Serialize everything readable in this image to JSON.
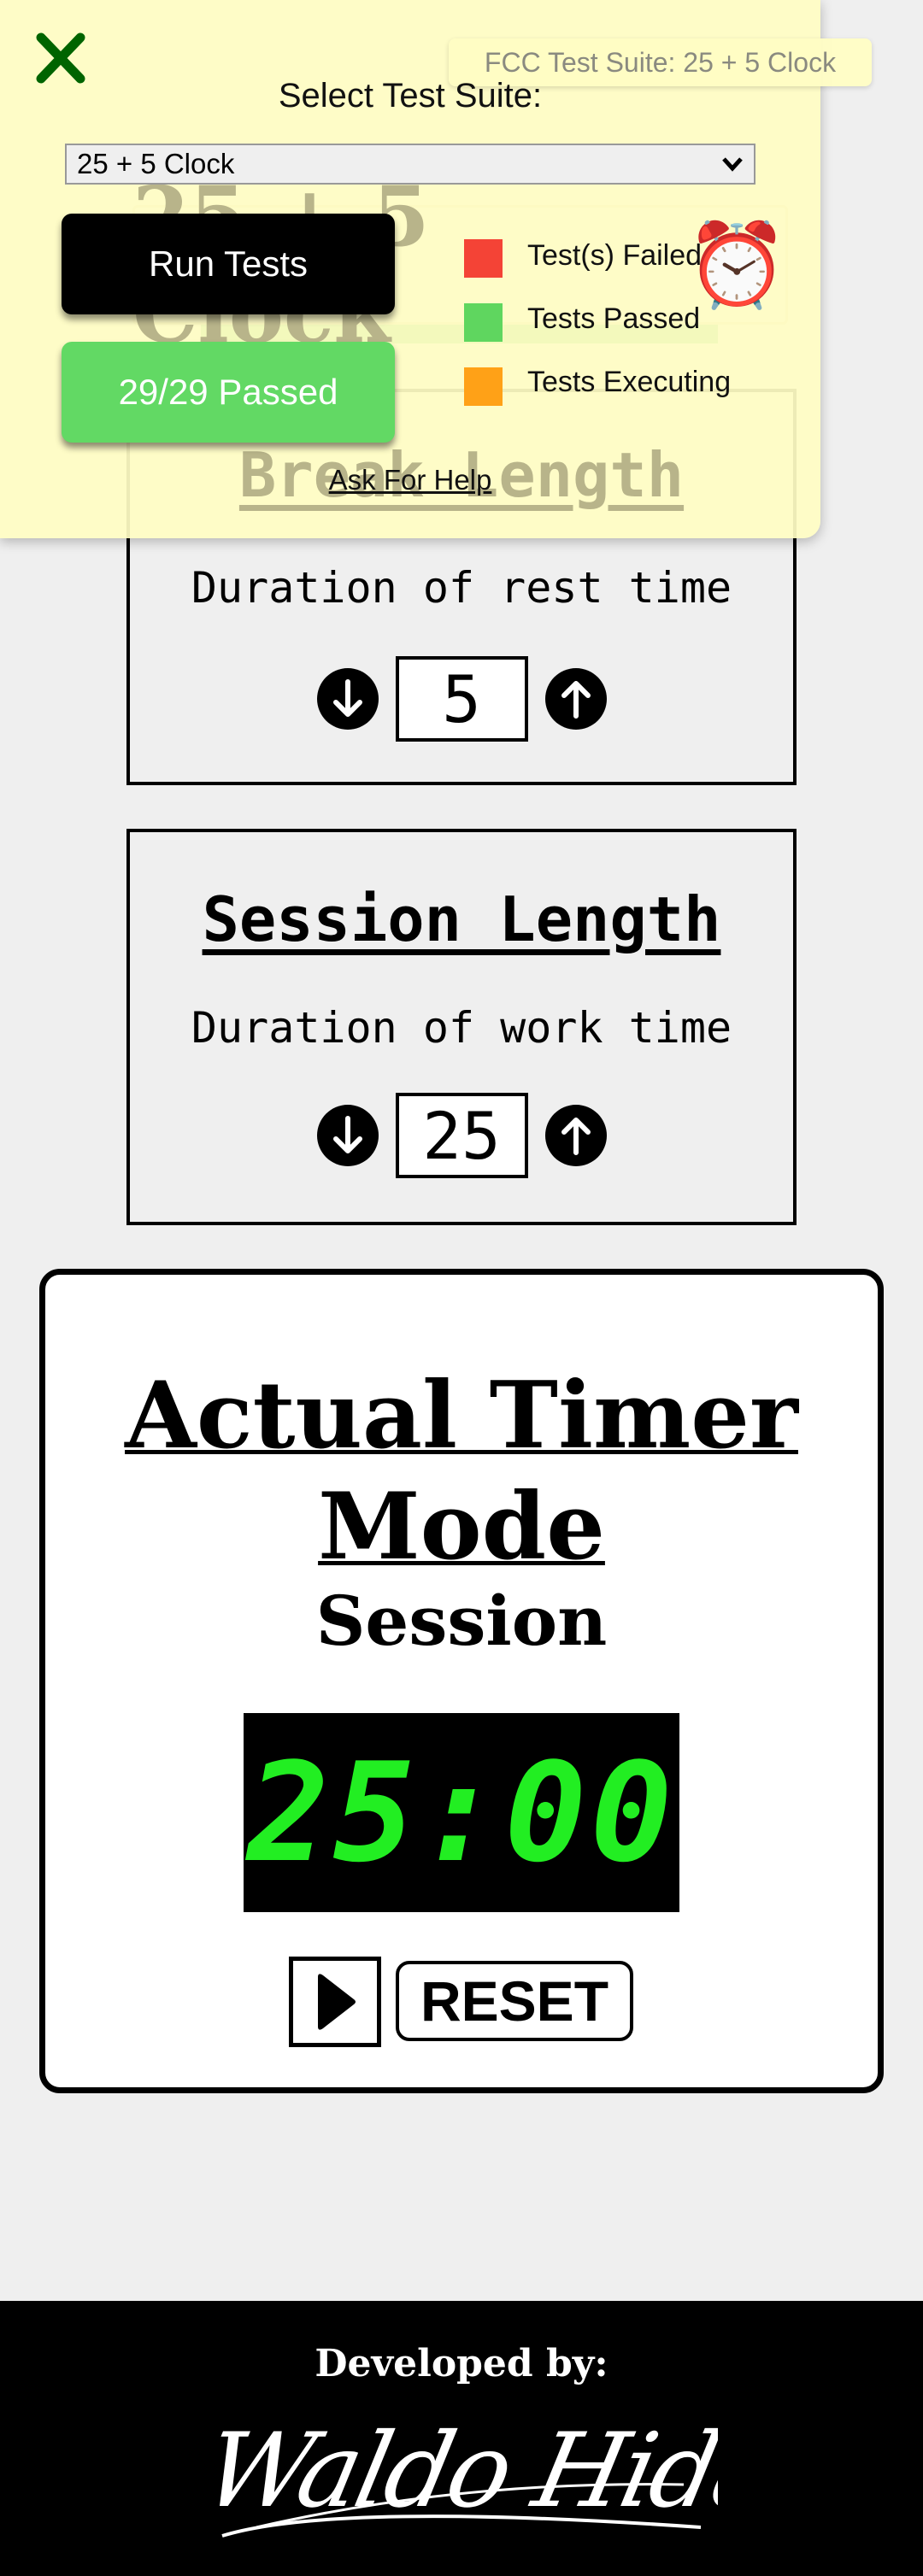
{
  "app": {
    "title": "25 + 5 Clock",
    "title_icon": "alarm-clock-icon"
  },
  "break": {
    "title": "Break Length",
    "subtitle": "Duration of rest time",
    "value": "5"
  },
  "session": {
    "title": "Session Length",
    "subtitle": "Duration of work time",
    "value": "25"
  },
  "timer": {
    "title_line1": "Actual Timer",
    "title_line2": "Mode",
    "label": "Session",
    "time": "25:00",
    "digit_color": "#22ee22",
    "play_icon": "play-icon",
    "reset_label": "RESET"
  },
  "footer": {
    "developed_by": "Developed by:",
    "signature": "Waldo Hidalgo."
  },
  "test_suite": {
    "badge": "FCC Test Suite: 25 + 5 Clock",
    "select_label": "Select Test Suite:",
    "selected": "25 + 5 Clock",
    "run_label": "Run Tests",
    "result_label": "29/29 Passed",
    "legend": [
      {
        "label": "Test(s) Failed",
        "color": "#f44336"
      },
      {
        "label": "Tests Passed",
        "color": "#5fd65f"
      },
      {
        "label": "Tests Executing",
        "color": "#ffa117"
      }
    ],
    "help_link": "Ask For Help",
    "close_icon": "close-icon",
    "pass_color": "#62d964"
  }
}
